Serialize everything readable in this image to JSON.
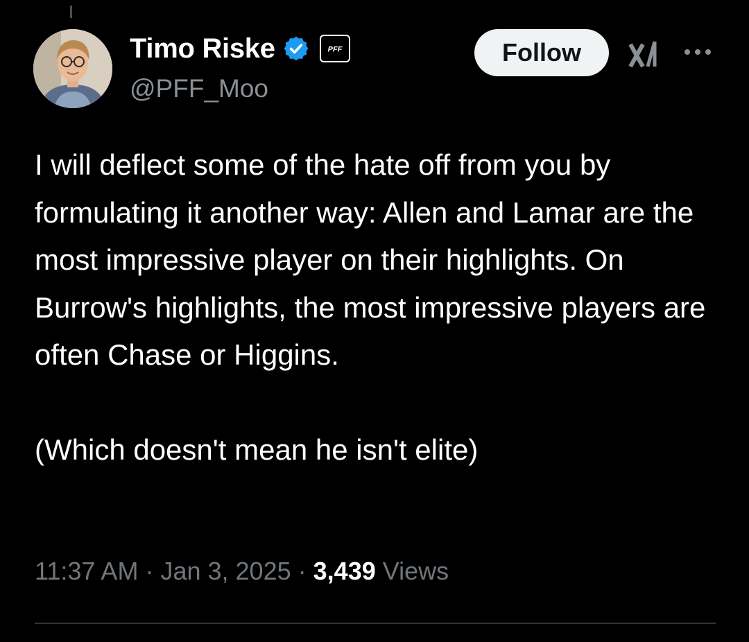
{
  "tweet": {
    "author": {
      "display_name": "Timo Riske",
      "handle": "@PFF_Moo",
      "verified": true,
      "verified_color": "#1d9bf0",
      "affiliate_badge_text": "PFF"
    },
    "actions": {
      "follow_label": "Follow",
      "grok_icon": "grok-icon",
      "more_icon": "more-options-icon"
    },
    "text": "I will deflect some of the hate off from you by formulating it another way: Allen and Lamar are the most impressive player on their highlights. On Burrow's highlights, the most impressive players are often Chase or Higgins.\n\n(Which doesn't mean he isn't elite)",
    "meta": {
      "time": "11:37 AM",
      "separator": "·",
      "date": "Jan 3, 2025",
      "views_count": "3,439",
      "views_label": "Views"
    }
  },
  "colors": {
    "background": "#000000",
    "text_primary": "#ffffff",
    "text_secondary": "#71767b",
    "follow_bg": "#eff3f4",
    "divider": "#2f3336"
  }
}
